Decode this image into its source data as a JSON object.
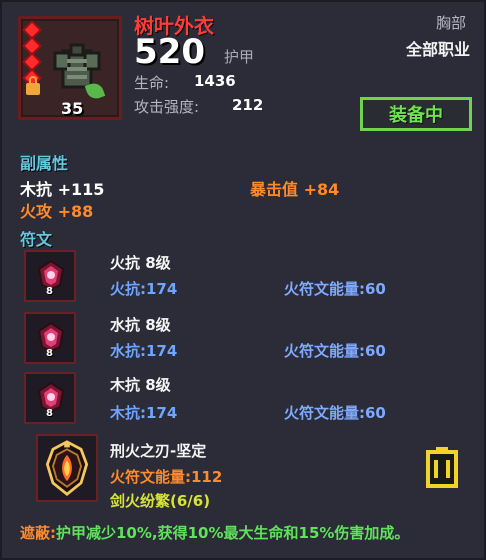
{
  "item": {
    "name": "树叶外衣",
    "armor_value": "520",
    "armor_label": "护甲",
    "life_label": "生命:",
    "life_value": "1436",
    "attack_label": "攻击强度:",
    "attack_value": "212",
    "slot": "胸部",
    "class": "全部职业",
    "level": "35",
    "equip_button": "装备中"
  },
  "secondary": {
    "title": "副属性",
    "line1": "木抗 +115",
    "line2": "暴击值 +84",
    "line3": "火攻 +88"
  },
  "runes": {
    "title": "符文",
    "rows": [
      {
        "title": "火抗 8级",
        "stat": "火抗:174",
        "energy": "火符文能量:60",
        "badge": "8"
      },
      {
        "title": "水抗 8级",
        "stat": "水抗:174",
        "energy": "火符文能量:60",
        "badge": "8"
      },
      {
        "title": "木抗 8级",
        "stat": "木抗:174",
        "energy": "火符文能量:60",
        "badge": "8"
      }
    ],
    "special": {
      "title": "刑火之刃-坚定",
      "energy": "火符文能量:112",
      "set": "剑火纷繁(6/6)"
    }
  },
  "footer": {
    "label": "遮蔽:",
    "text": "护甲减少10%,获得10%最大生命和15%伤害加成。"
  },
  "colors": {
    "name_red": "#ff3c3c",
    "section_cyan": "#64c7df",
    "equip_green": "#73d34f",
    "accent_orange": "#ff8a2b",
    "rune_blue": "#6fa5ff",
    "set_yellow": "#d7e33a"
  },
  "icons": {
    "item": "leaf-armor-icon",
    "lock": "lock-icon",
    "rune": "rune-gem-icon",
    "special": "flame-crest-icon",
    "action": "yellow-battery-icon"
  }
}
